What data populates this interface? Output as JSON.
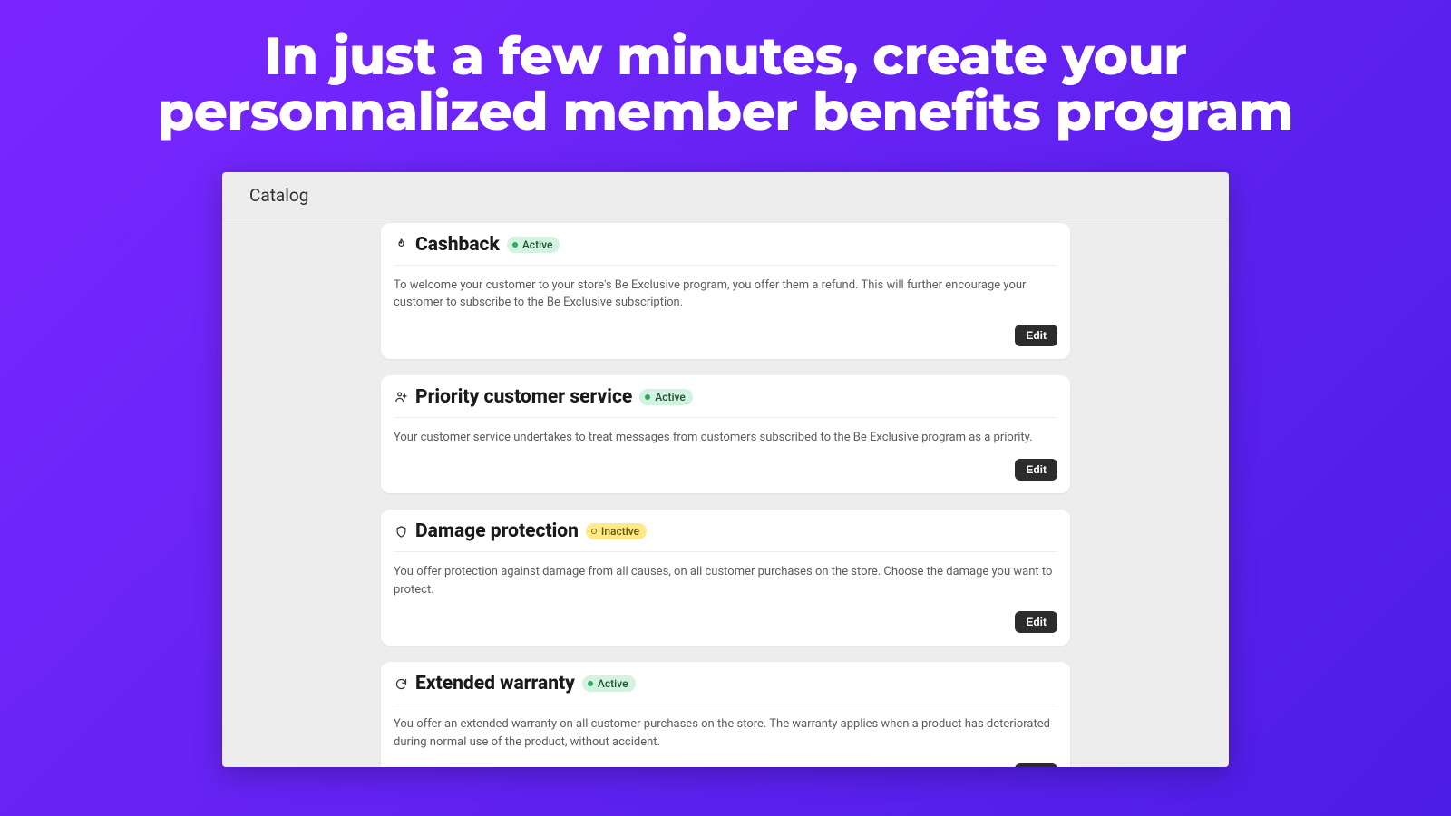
{
  "hero": {
    "title_line1": "In just a few minutes, create your",
    "title_line2": "personnalized member benefits program"
  },
  "app": {
    "header_title": "Catalog",
    "edit_label": "Edit",
    "status_labels": {
      "active": "Active",
      "inactive": "Inactive"
    },
    "cards": [
      {
        "icon": "flame-icon",
        "title": "Cashback",
        "status": "active",
        "description": "To welcome your customer to your store's Be Exclusive program, you offer them a refund. This will further encourage your customer to subscribe to the Be Exclusive subscription."
      },
      {
        "icon": "user-plus-icon",
        "title": "Priority customer service",
        "status": "active",
        "description": "Your customer service undertakes to treat messages from customers subscribed to the Be Exclusive program as a priority."
      },
      {
        "icon": "shield-icon",
        "title": "Damage protection",
        "status": "inactive",
        "description": "You offer protection against damage from all causes, on all customer purchases on the store. Choose the damage you want to protect."
      },
      {
        "icon": "refresh-icon",
        "title": "Extended warranty",
        "status": "active",
        "description": "You offer an extended warranty on all customer purchases on the store. The warranty applies when a product has deteriorated during normal use of the product, without accident."
      }
    ]
  }
}
